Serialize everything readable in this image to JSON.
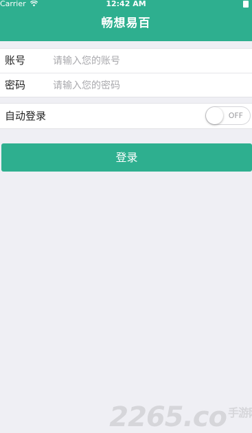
{
  "status_bar": {
    "carrier": "Carrier",
    "time": "12:42 AM"
  },
  "nav": {
    "title": "畅想易百"
  },
  "form": {
    "account": {
      "label": "账号",
      "placeholder": "请输入您的账号",
      "value": ""
    },
    "password": {
      "label": "密码",
      "placeholder": "请输入您的密码",
      "value": ""
    }
  },
  "auto_login": {
    "label": "自动登录",
    "toggle_state": "OFF"
  },
  "login_button": {
    "label": "登录"
  },
  "watermark": {
    "brand": "2265",
    "tail": ".co",
    "suffix": "手游网"
  },
  "colors": {
    "accent": "#2EAF8F",
    "background": "#EFEFF4"
  }
}
